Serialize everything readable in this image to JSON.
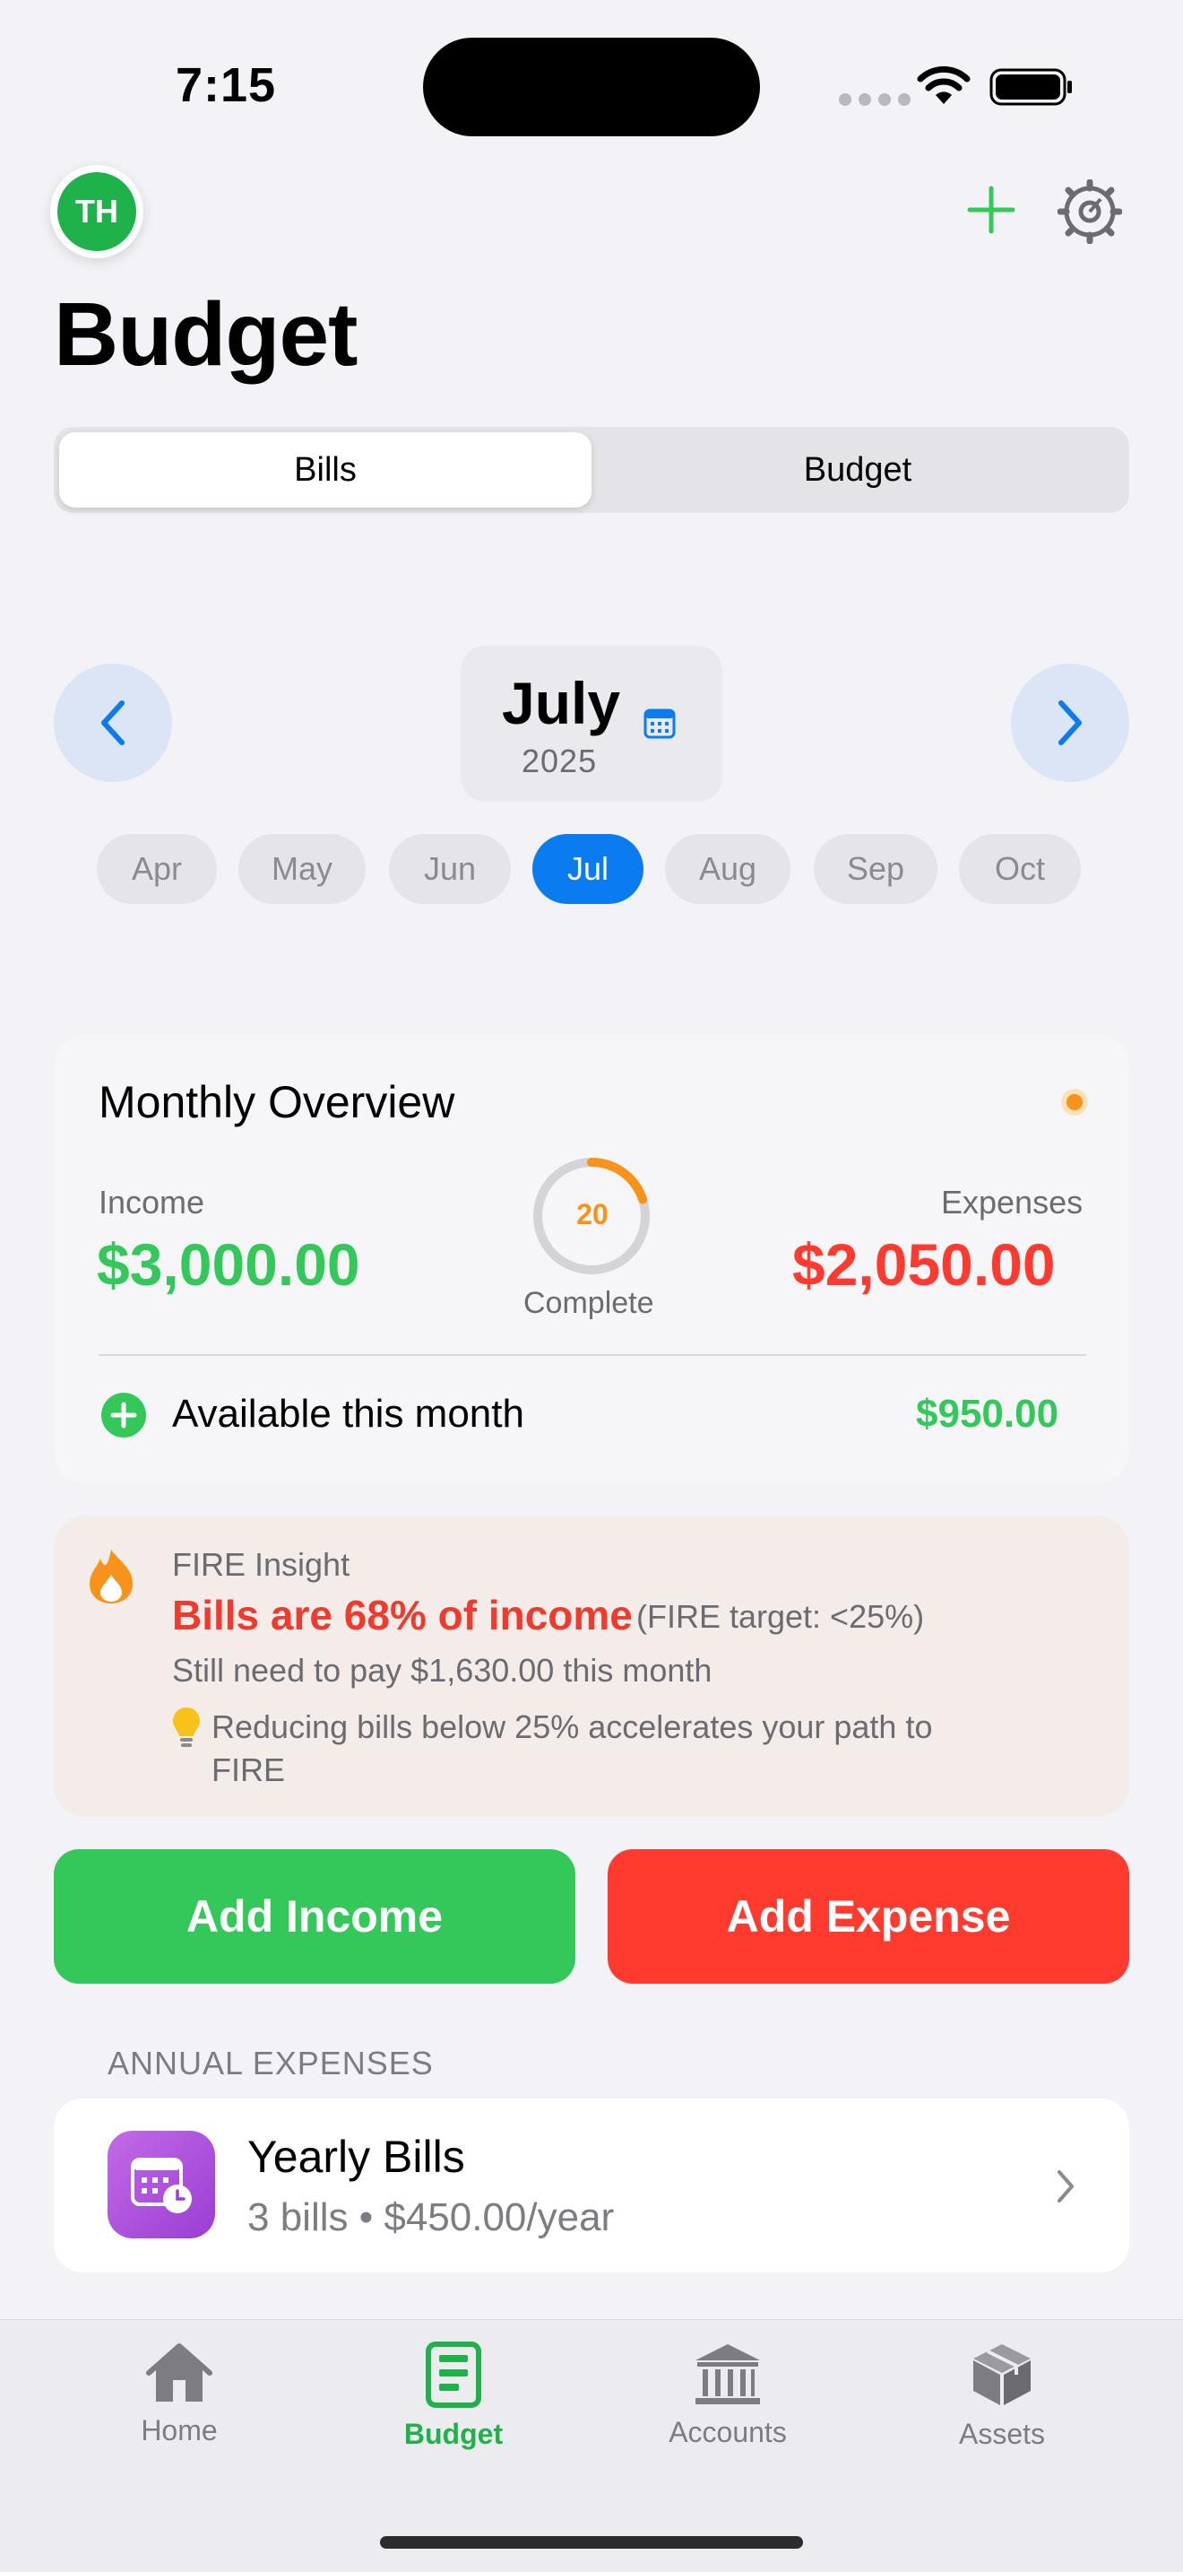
{
  "status_bar": {
    "time": "7:15"
  },
  "header": {
    "avatar_initials": "TH",
    "title": "Budget"
  },
  "segmented": {
    "tabs": [
      "Bills",
      "Budget"
    ],
    "selected": "Bills"
  },
  "month_nav": {
    "month": "July",
    "year": "2025",
    "chips": [
      "Apr",
      "May",
      "Jun",
      "Jul",
      "Aug",
      "Sep",
      "Oct"
    ],
    "selected": "Jul"
  },
  "overview": {
    "title": "Monthly Overview",
    "income_label": "Income",
    "income_value": "$3,000.00",
    "expenses_label": "Expenses",
    "expenses_value": "$2,050.00",
    "progress_value": "20",
    "progress_fraction": 0.2,
    "progress_label": "Complete",
    "available_label": "Available this month",
    "available_value": "$950.00"
  },
  "fire": {
    "title": "FIRE Insight",
    "headline": "Bills are 68% of income",
    "target": "(FIRE target: <25%)",
    "pay_note": "Still need to pay $1,630.00 this month",
    "tip": "Reducing bills below 25% accelerates your path to FIRE"
  },
  "actions": {
    "add_income": "Add Income",
    "add_expense": "Add Expense"
  },
  "annual": {
    "section_label": "ANNUAL EXPENSES",
    "yearly_title": "Yearly Bills",
    "yearly_subtitle": "3 bills • $450.00/year"
  },
  "tabbar": {
    "items": [
      "Home",
      "Budget",
      "Accounts",
      "Assets"
    ],
    "selected": "Budget"
  },
  "colors": {
    "accent_green": "#34c759",
    "accent_red": "#ff3b30",
    "accent_blue": "#0a7cf0",
    "accent_orange": "#f7931a"
  }
}
